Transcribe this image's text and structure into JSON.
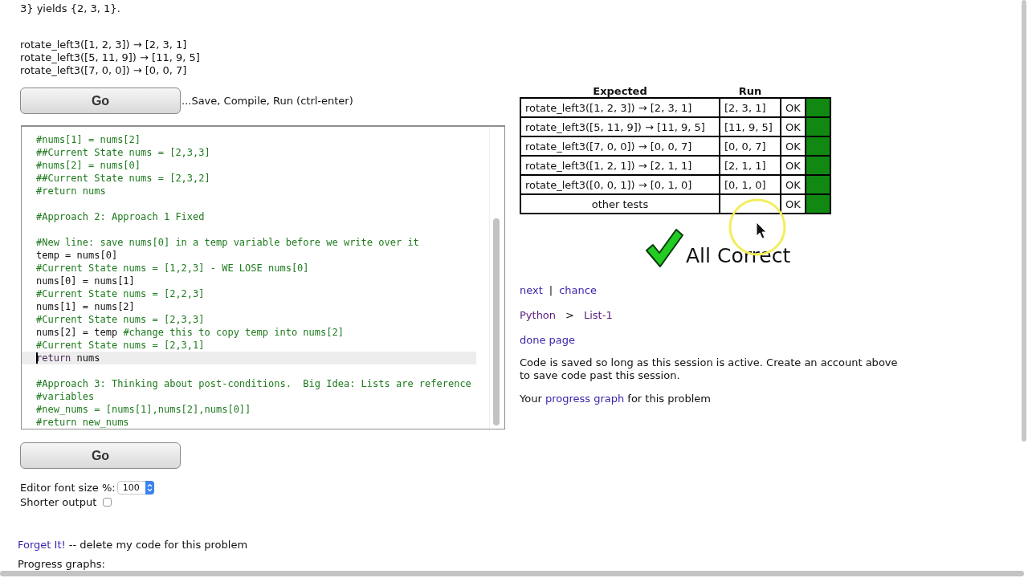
{
  "problem": {
    "intro_tail": "3} yields {2, 3, 1}.",
    "examples": [
      "rotate_left3([1, 2, 3]) → [2, 3, 1]",
      "rotate_left3([5, 11, 9]) → [11, 9, 5]",
      "rotate_left3([7, 0, 0]) → [0, 0, 7]"
    ]
  },
  "go_buttons": [
    {
      "label": "Go",
      "hint": "...Save, Compile, Run (ctrl-enter)"
    },
    {
      "label": "Go"
    }
  ],
  "editor": {
    "lines": [
      {
        "current": false,
        "segments": [
          {
            "kind": "comment",
            "text": "#nums[1] = nums[2]"
          }
        ]
      },
      {
        "current": false,
        "segments": [
          {
            "kind": "comment",
            "text": "##Current State nums = [2,3,3]"
          }
        ]
      },
      {
        "current": false,
        "segments": [
          {
            "kind": "comment",
            "text": "#nums[2] = nums[0]"
          }
        ]
      },
      {
        "current": false,
        "segments": [
          {
            "kind": "comment",
            "text": "##Current State nums = [2,3,2]"
          }
        ]
      },
      {
        "current": false,
        "segments": [
          {
            "kind": "comment",
            "text": "#return nums"
          }
        ]
      },
      {
        "current": false
      },
      {
        "current": false,
        "segments": [
          {
            "kind": "comment",
            "text": "#Approach 2: Approach 1 Fixed"
          }
        ]
      },
      {
        "current": false
      },
      {
        "current": false,
        "segments": [
          {
            "kind": "comment",
            "text": "#New line: save nums[0] in a temp variable before we write over it"
          }
        ]
      },
      {
        "current": false,
        "segments": [
          {
            "kind": "code",
            "text": "temp = nums[0]"
          }
        ]
      },
      {
        "current": false,
        "segments": [
          {
            "kind": "comment",
            "text": "#Current State nums = [1,2,3] - WE LOSE nums[0]"
          }
        ]
      },
      {
        "current": false,
        "segments": [
          {
            "kind": "code",
            "text": "nums[0] = nums[1]"
          }
        ]
      },
      {
        "current": false,
        "segments": [
          {
            "kind": "comment",
            "text": "#Current State nums = [2,2,3]"
          }
        ]
      },
      {
        "current": false,
        "segments": [
          {
            "kind": "code",
            "text": "nums[1] = nums[2]"
          }
        ]
      },
      {
        "current": false,
        "segments": [
          {
            "kind": "comment",
            "text": "#Current State nums = [2,3,3]"
          }
        ]
      },
      {
        "current": false,
        "segments": [
          {
            "kind": "code",
            "text": "nums[2] = temp "
          },
          {
            "kind": "comment",
            "text": "#change this to copy temp into nums[2]"
          }
        ]
      },
      {
        "current": false,
        "segments": [
          {
            "kind": "comment",
            "text": "#Current State nums = [2,3,1]"
          }
        ]
      },
      {
        "current": true,
        "segments": [
          {
            "kind": "keyword",
            "text": "return"
          },
          {
            "kind": "code",
            "text": " nums"
          }
        ]
      },
      {
        "current": false
      },
      {
        "current": false,
        "segments": [
          {
            "kind": "comment",
            "text": "#Approach 3: Thinking about post-conditions.  Big Idea: Lists are reference"
          }
        ]
      },
      {
        "current": false,
        "segments": [
          {
            "kind": "comment",
            "text": "#variables"
          }
        ]
      },
      {
        "current": false,
        "segments": [
          {
            "kind": "comment",
            "text": "#new_nums = [nums[1],nums[2],nums[0]]"
          }
        ]
      },
      {
        "current": false,
        "segments": [
          {
            "kind": "comment",
            "text": "#return new_nums"
          }
        ]
      }
    ]
  },
  "options": {
    "font_size_label": "Editor font size %:",
    "font_size": "100",
    "shorter_label": "Shorter output",
    "shorter_checked": false
  },
  "forget": {
    "link": "Forget It!",
    "text": " -- delete my code for this problem"
  },
  "progress_heading": "Progress graphs:",
  "results": {
    "columns": [
      "Expected",
      "Run"
    ],
    "rows": [
      {
        "kind": "test",
        "expected": "rotate_left3([1, 2, 3]) → [2, 3, 1]",
        "run": "[2, 3, 1]",
        "status": "OK",
        "passed": true
      },
      {
        "kind": "test",
        "expected": "rotate_left3([5, 11, 9]) → [11, 9, 5]",
        "run": "[11, 9, 5]",
        "status": "OK",
        "passed": true
      },
      {
        "kind": "test",
        "expected": "rotate_left3([7, 0, 0]) → [0, 0, 7]",
        "run": "[0, 0, 7]",
        "status": "OK",
        "passed": true
      },
      {
        "kind": "test",
        "expected": "rotate_left3([1, 2, 1]) → [2, 1, 1]",
        "run": "[2, 1, 1]",
        "status": "OK",
        "passed": true
      },
      {
        "kind": "test",
        "expected": "rotate_left3([0, 0, 1]) → [0, 1, 0]",
        "run": "[0, 1, 0]",
        "status": "OK",
        "passed": true
      },
      {
        "kind": "summary",
        "expected": "other tests",
        "status": "OK",
        "passed": true
      }
    ],
    "verdict": "All Correct"
  },
  "nav": {
    "links": [
      {
        "label": "next",
        "visited": false
      },
      {
        "label": "chance",
        "visited": false
      }
    ],
    "separator": "|"
  },
  "breadcrumb": {
    "items": [
      {
        "label": "Python",
        "visited": true
      },
      {
        "label": "List-1",
        "visited": true
      }
    ],
    "separator": ">"
  },
  "done_link": "done page",
  "session_note": "Code is saved so long as this session is active. Create an account above to save code past this session.",
  "progress_note": {
    "before": "Your ",
    "link": "progress graph",
    "after": " for this problem"
  }
}
